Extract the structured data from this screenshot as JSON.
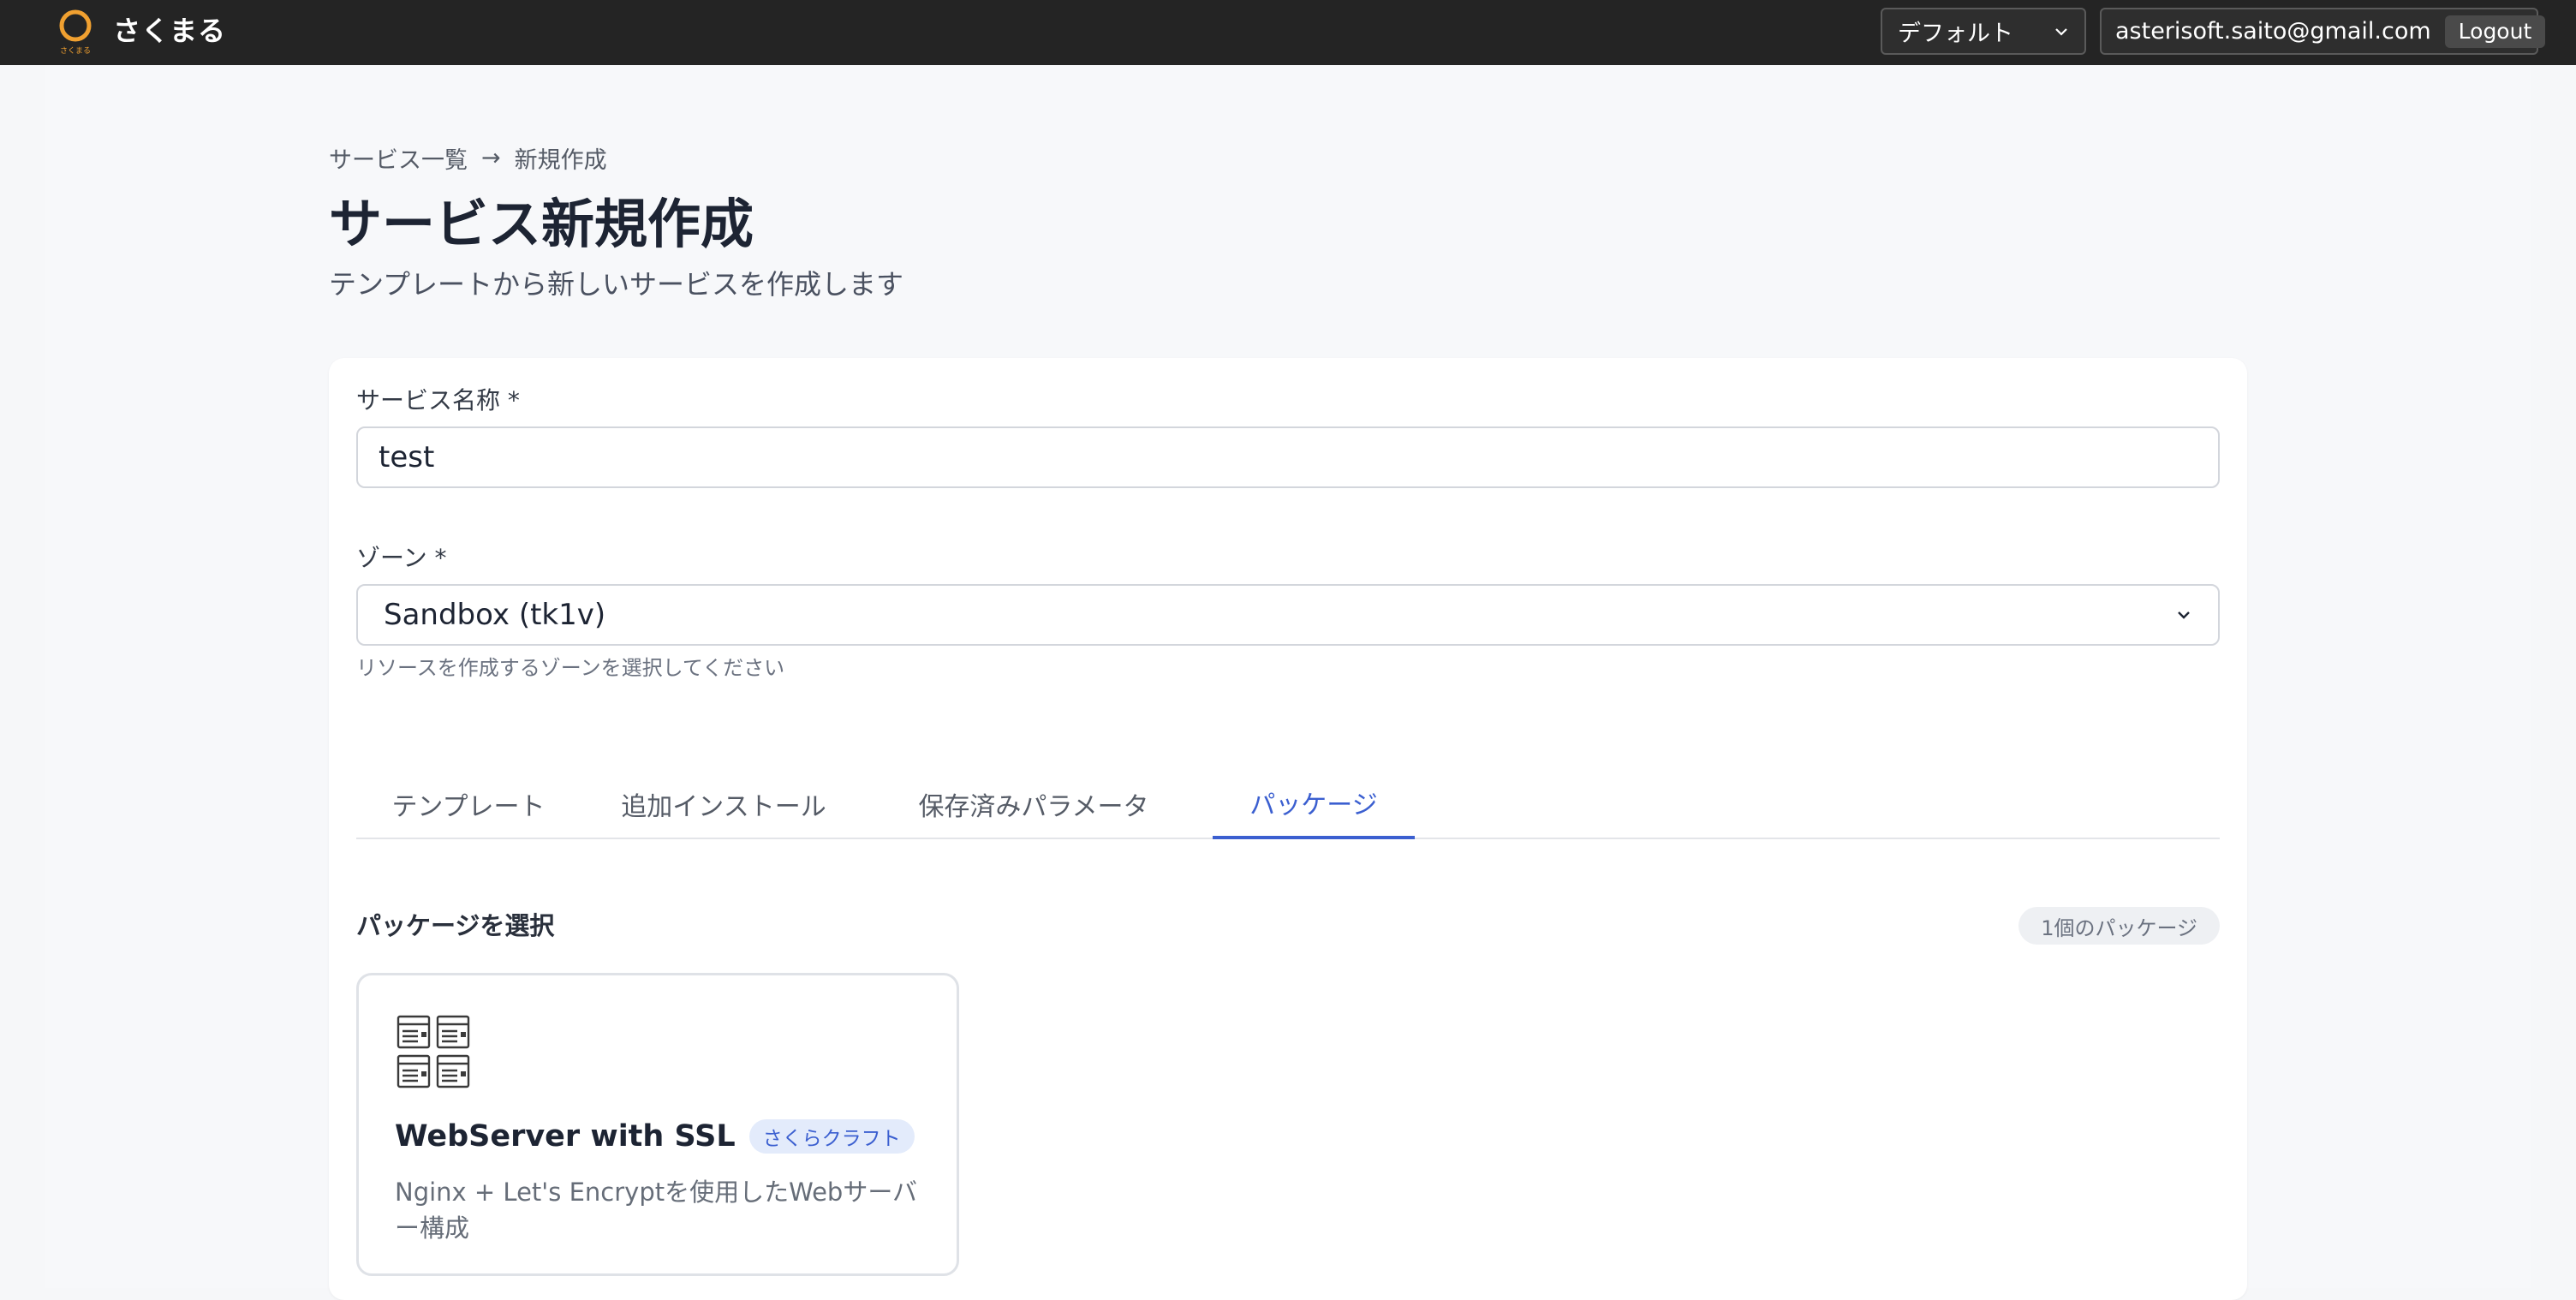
{
  "app": {
    "name": "さくまる",
    "logo_caption": "さくまる"
  },
  "header": {
    "project_select_value": "デフォルト",
    "user_email": "asterisoft.saito@gmail.com",
    "logout_label": "Logout"
  },
  "breadcrumb": {
    "parent": "サービス一覧",
    "separator": "→",
    "current": "新規作成"
  },
  "page": {
    "title": "サービス新規作成",
    "subtitle": "テンプレートから新しいサービスを作成します"
  },
  "form": {
    "service_name_label": "サービス名称 *",
    "service_name_value": "test",
    "zone_label": "ゾーン *",
    "zone_value": "Sandbox (tk1v)",
    "zone_help": "リソースを作成するゾーンを選択してください"
  },
  "tabs": [
    {
      "label": "テンプレート"
    },
    {
      "label": "追加インストール"
    },
    {
      "label": "保存済みパラメータ"
    },
    {
      "label": "パッケージ",
      "active": true
    }
  ],
  "packages": {
    "section_title": "パッケージを選択",
    "count_label": "1個のパッケージ",
    "items": [
      {
        "icon": "web-servers-icon",
        "name": "WebServer with SSL",
        "tag": "さくらクラフト",
        "description": "Nginx + Let's Encryptを使用したWebサーバー構成"
      }
    ]
  },
  "colors": {
    "accent": "#3b5fd0",
    "topbar": "#242424",
    "logo_orange": "#f0a030"
  }
}
